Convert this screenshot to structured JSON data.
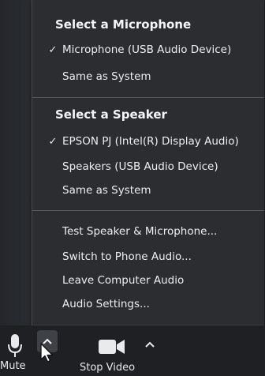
{
  "menu": {
    "microphone_heading": "Select a Microphone",
    "microphones": [
      {
        "label": "Microphone (USB Audio Device)",
        "check": "✓"
      },
      {
        "label": "Same as System",
        "check": ""
      }
    ],
    "speaker_heading": "Select a Speaker",
    "speakers": [
      {
        "label": "EPSON PJ (Intel(R) Display Audio)",
        "check": "✓"
      },
      {
        "label": "Speakers (USB Audio Device)",
        "check": ""
      },
      {
        "label": "Same as System",
        "check": ""
      }
    ],
    "actions": [
      {
        "label": "Test Speaker & Microphone..."
      },
      {
        "label": "Switch to Phone Audio..."
      },
      {
        "label": "Leave Computer Audio"
      },
      {
        "label": "Audio Settings..."
      }
    ]
  },
  "toolbar": {
    "mute_label": "Mute",
    "video_label": "Stop Video"
  },
  "icons": {
    "mute": "microphone-icon",
    "mute_arrow": "chevron-up-icon",
    "video": "video-camera-icon",
    "video_arrow": "chevron-up-icon",
    "cursor": "mouse-pointer-icon"
  }
}
